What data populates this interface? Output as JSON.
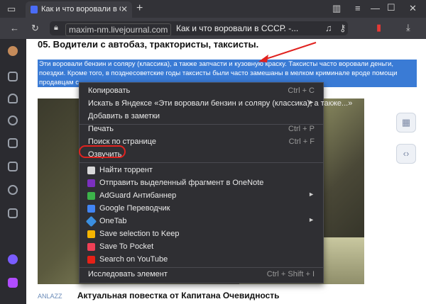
{
  "browser": {
    "tab_title": "Как и что воровали в С",
    "tab_close": "✕",
    "new_tab": "+",
    "window_controls": {
      "minimize": "—",
      "maximize": "☐",
      "close": "✕"
    },
    "url_domain": "maxim-nm.livejournal.com",
    "url_page_title": "Как и что воровали в СССР. -..."
  },
  "article": {
    "heading": "05. Водители с автобаз, трактористы, таксисты.",
    "selected_lines": [
      "Эти воровали бензин и соляру (классика), а также запчасти и кузовную краску. Таксисты часто воровали деньги,",
      "поездки. Кроме того, в позднесоветские годы таксисты были часто замешаны в мелком криминале вроде помощи",
      "продавцам с"
    ],
    "bottom_source": "ANLAZZ",
    "bottom_title": "Актуальная повестка от Капитана Очевидность"
  },
  "context_menu": {
    "items": [
      {
        "label": "Копировать",
        "shortcut": "Ctrl + C"
      },
      {
        "label": "Искать в Яндексе «Эти воровали бензин и соляру (классика), а также...»",
        "arrow": "►"
      },
      {
        "label": "Добавить в заметки"
      },
      {
        "label": "Печать",
        "shortcut": "Ctrl + P"
      },
      {
        "label": "Поиск по странице",
        "shortcut": "Ctrl + F"
      },
      {
        "label": "Озвучить"
      },
      {
        "label": "Найти торрент",
        "icon_color": "#2a2a2a"
      },
      {
        "label": "Отправить выделенный фрагмент в OneNote",
        "icon_color": "#7b2fbf"
      },
      {
        "label": "AdGuard Антибаннер",
        "icon_color": "#3cb34a",
        "arrow": "►"
      },
      {
        "label": "Google Переводчик",
        "icon_color": "#4285f4"
      },
      {
        "label": "OneTab",
        "icon_color": "#3b8fe0",
        "arrow": "►"
      },
      {
        "label": "Save selection to Keep",
        "icon_color": "#f5b400"
      },
      {
        "label": "Save To Pocket",
        "icon_color": "#ef4056"
      },
      {
        "label": "Search on YouTube",
        "icon_color": "#e62117"
      },
      {
        "label": "Исследовать элемент",
        "shortcut": "Ctrl + Shift + I"
      }
    ]
  },
  "colors": {
    "selection": "#3a7bd5",
    "annotation_red": "#e0221f",
    "menu_bg": "#2f2f33"
  }
}
